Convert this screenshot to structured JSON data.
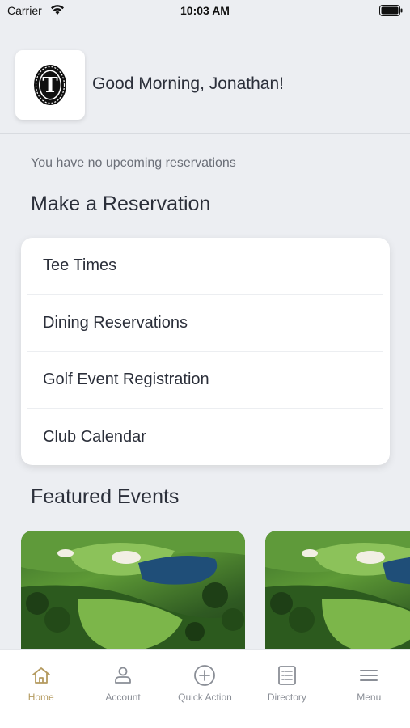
{
  "status_bar": {
    "carrier": "Carrier",
    "time": "10:03 AM"
  },
  "header": {
    "greeting": "Good Morning, Jonathan!",
    "logo_letter": "T"
  },
  "reservations": {
    "empty_message": "You have no upcoming reservations",
    "title": "Make a Reservation",
    "items": [
      {
        "label": "Tee Times"
      },
      {
        "label": "Dining Reservations"
      },
      {
        "label": "Golf Event Registration"
      },
      {
        "label": "Club Calendar"
      }
    ]
  },
  "featured": {
    "title": "Featured Events"
  },
  "tab_bar": {
    "tabs": [
      {
        "label": "Home",
        "icon": "home-icon",
        "active": true
      },
      {
        "label": "Account",
        "icon": "account-icon",
        "active": false
      },
      {
        "label": "Quick Action",
        "icon": "plus-circle-icon",
        "active": false
      },
      {
        "label": "Directory",
        "icon": "list-icon",
        "active": false
      },
      {
        "label": "Menu",
        "icon": "menu-icon",
        "active": false
      }
    ]
  },
  "colors": {
    "accent": "#b49a5f",
    "background": "#eceef2",
    "text": "#2b2f3a"
  }
}
